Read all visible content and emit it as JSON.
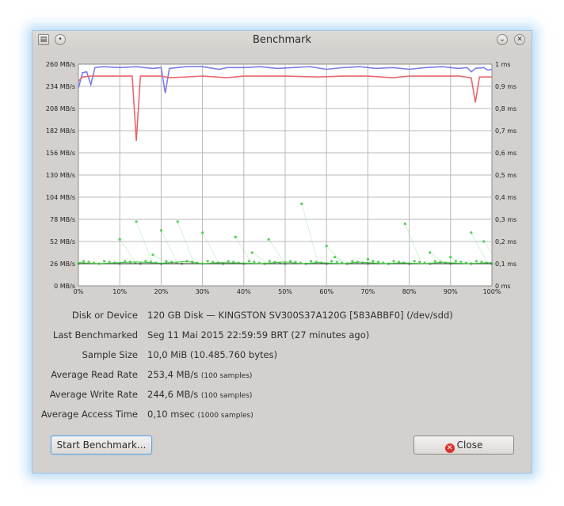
{
  "window": {
    "title": "Benchmark"
  },
  "chart_data": {
    "type": "line",
    "x_ticks": [
      "0%",
      "10%",
      "20%",
      "30%",
      "40%",
      "50%",
      "60%",
      "70%",
      "80%",
      "90%",
      "100%"
    ],
    "y_left_ticks": [
      "0 MB/s",
      "26 MB/s",
      "52 MB/s",
      "78 MB/s",
      "104 MB/s",
      "130 MB/s",
      "156 MB/s",
      "182 MB/s",
      "208 MB/s",
      "234 MB/s",
      "260 MB/s"
    ],
    "y_right_ticks": [
      "0 ms",
      "0,1 ms",
      "0,2 ms",
      "0,3 ms",
      "0,4 ms",
      "0,5 ms",
      "0,6 ms",
      "0,7 ms",
      "0,8 ms",
      "0,9 ms",
      "1 ms"
    ],
    "ylim_left": [
      0,
      260
    ],
    "ylim_right": [
      0,
      1
    ],
    "grid": true,
    "series": [
      {
        "color": "#7b7ee6",
        "points": [
          [
            0,
            232
          ],
          [
            1,
            250
          ],
          [
            2,
            251
          ],
          [
            3,
            236
          ],
          [
            4,
            256
          ],
          [
            6,
            257
          ],
          [
            10,
            256
          ],
          [
            14,
            257
          ],
          [
            16,
            256
          ],
          [
            18,
            255
          ],
          [
            20,
            256
          ],
          [
            21,
            226
          ],
          [
            22,
            255
          ],
          [
            26,
            257
          ],
          [
            30,
            257
          ],
          [
            34,
            254
          ],
          [
            36,
            256
          ],
          [
            40,
            256
          ],
          [
            44,
            257
          ],
          [
            48,
            255
          ],
          [
            52,
            256
          ],
          [
            56,
            257
          ],
          [
            60,
            254
          ],
          [
            64,
            256
          ],
          [
            68,
            257
          ],
          [
            72,
            255
          ],
          [
            76,
            256
          ],
          [
            80,
            254
          ],
          [
            84,
            256
          ],
          [
            88,
            257
          ],
          [
            92,
            255
          ],
          [
            94,
            256
          ],
          [
            95,
            251
          ],
          [
            96,
            255
          ],
          [
            98,
            256
          ],
          [
            99,
            253
          ],
          [
            100,
            254
          ]
        ]
      },
      {
        "color": "#e8676b",
        "points": [
          [
            0,
            240
          ],
          [
            1,
            245
          ],
          [
            3,
            246
          ],
          [
            10,
            246
          ],
          [
            13,
            246
          ],
          [
            14,
            170
          ],
          [
            15,
            246
          ],
          [
            20,
            246
          ],
          [
            22,
            244
          ],
          [
            30,
            246
          ],
          [
            36,
            244
          ],
          [
            40,
            246
          ],
          [
            50,
            246
          ],
          [
            58,
            245
          ],
          [
            64,
            246
          ],
          [
            70,
            246
          ],
          [
            76,
            244
          ],
          [
            80,
            246
          ],
          [
            86,
            246
          ],
          [
            92,
            246
          ],
          [
            95,
            244
          ],
          [
            96,
            215
          ],
          [
            97,
            245
          ],
          [
            100,
            245
          ]
        ]
      },
      {
        "color": "#39c43a",
        "points": [
          [
            0,
            0.105
          ],
          [
            5,
            0.1
          ],
          [
            10,
            0.105
          ],
          [
            14,
            0.108
          ],
          [
            20,
            0.102
          ],
          [
            26,
            0.11
          ],
          [
            30,
            0.1
          ],
          [
            34,
            0.105
          ],
          [
            40,
            0.103
          ],
          [
            44,
            0.1
          ],
          [
            50,
            0.108
          ],
          [
            54,
            0.1
          ],
          [
            58,
            0.105
          ],
          [
            64,
            0.1
          ],
          [
            68,
            0.107
          ],
          [
            74,
            0.1
          ],
          [
            78,
            0.104
          ],
          [
            84,
            0.1
          ],
          [
            88,
            0.106
          ],
          [
            94,
            0.1
          ],
          [
            100,
            0.105
          ]
        ]
      }
    ],
    "access_scatter": [
      [
        10,
        0.21
      ],
      [
        14,
        0.29
      ],
      [
        20,
        0.25
      ],
      [
        24,
        0.29
      ],
      [
        30,
        0.24
      ],
      [
        38,
        0.22
      ],
      [
        46,
        0.21
      ],
      [
        54,
        0.37
      ],
      [
        62,
        0.13
      ],
      [
        70,
        0.12
      ],
      [
        79,
        0.28
      ],
      [
        85,
        0.15
      ],
      [
        95,
        0.24
      ],
      [
        98,
        0.2
      ],
      [
        18,
        0.14
      ],
      [
        42,
        0.15
      ],
      [
        60,
        0.18
      ],
      [
        90,
        0.13
      ]
    ]
  },
  "info": {
    "device_label": "Disk or Device",
    "device_value": "120 GB Disk — KINGSTON SV300S37A120G [583ABBF0] (/dev/sdd)",
    "last_label": "Last Benchmarked",
    "last_value": "Seg 11 Mai 2015 22:59:59 BRT (27 minutes ago)",
    "sample_label": "Sample Size",
    "sample_value": "10,0 MiB (10.485.760 bytes)",
    "read_label": "Average Read Rate",
    "read_value": "253,4 MB/s",
    "read_samples": "(100 samples)",
    "write_label": "Average Write Rate",
    "write_value": "244,6 MB/s",
    "write_samples": "(100 samples)",
    "access_label": "Average Access Time",
    "access_value": "0,10 msec",
    "access_samples": "(1000 samples)"
  },
  "buttons": {
    "start_label": "Start Benchmark...",
    "close_label": "Close"
  }
}
